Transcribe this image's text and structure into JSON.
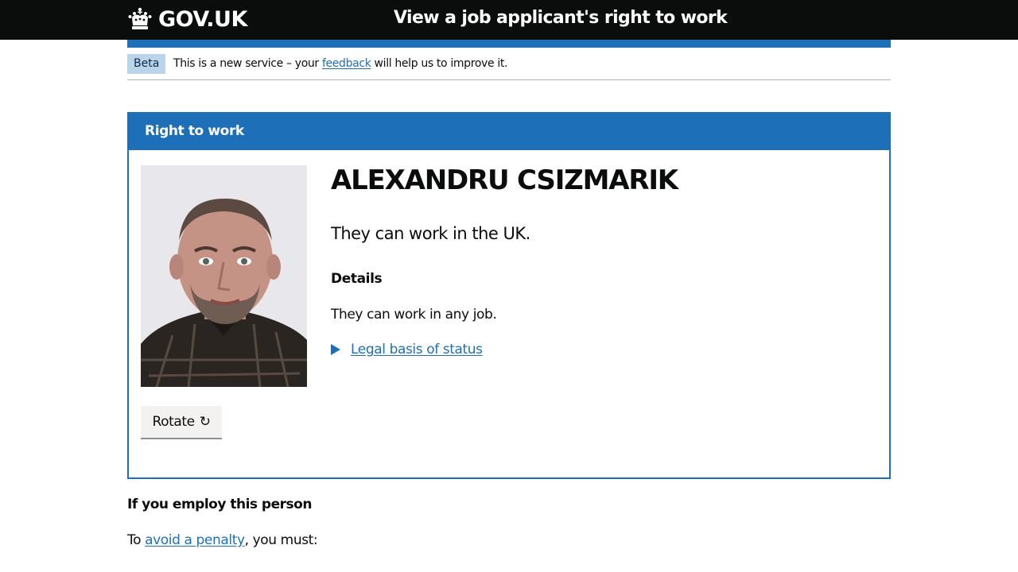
{
  "header": {
    "logo_text": "GOV.UK",
    "service_name": "View a job applicant's right to work"
  },
  "phase_banner": {
    "tag": "Beta",
    "text_before": "This is a new service – your ",
    "link": "feedback",
    "text_after": " will help us to improve it."
  },
  "panel": {
    "title": "Right to work",
    "name": "ALEXANDRU CSIZMARIK",
    "status": "They can work in the UK.",
    "details_heading": "Details",
    "details_text": "They can work in any job.",
    "legal_link": "Legal basis of status",
    "rotate_label": "Rotate",
    "rotate_icon": "↻"
  },
  "employ": {
    "heading": "If you employ this person",
    "text_before": "To ",
    "link": "avoid a penalty",
    "text_after": ", you must:"
  },
  "colors": {
    "header_bg": "#0b0c0c",
    "accent_blue": "#1d70b8",
    "beta_tag_bg": "#bbd4ea",
    "button_bg": "#f3f2f1"
  }
}
